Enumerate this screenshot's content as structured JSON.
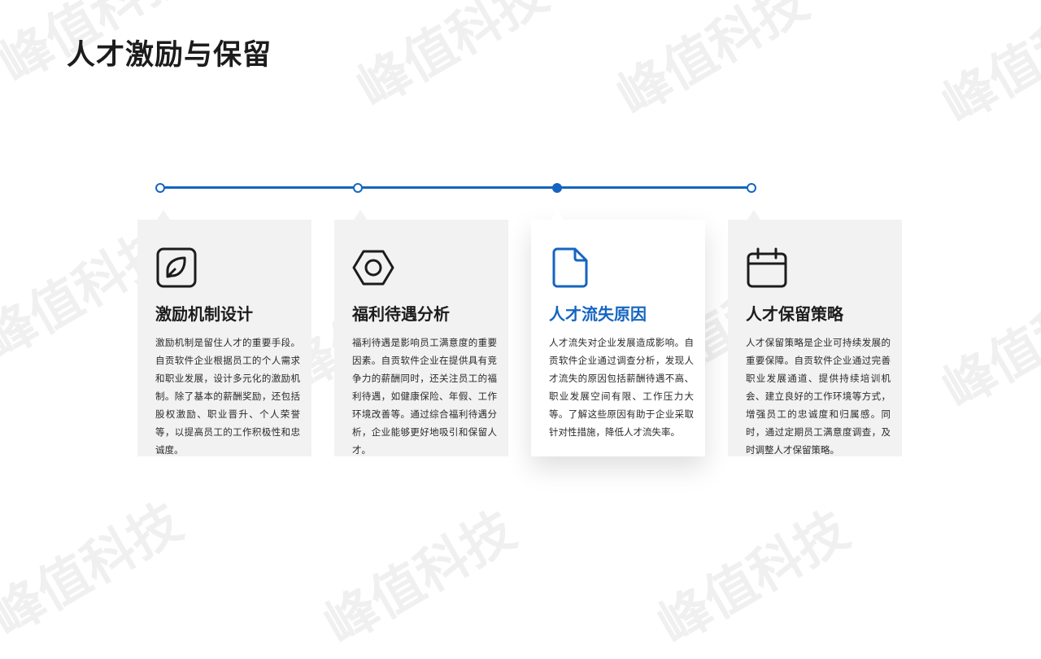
{
  "page": {
    "title": "人才激励与保留",
    "watermark": "峰值科技"
  },
  "colors": {
    "accent": "#1565c0",
    "card_bg": "#f2f2f2",
    "text": "#1c1c1c"
  },
  "timeline": {
    "active_index": 2,
    "points": 4
  },
  "cards": [
    {
      "icon": "leaf-icon",
      "title": "激励机制设计",
      "text": "激励机制是留住人才的重要手段。自贡软件企业根据员工的个人需求和职业发展，设计多元化的激励机制。除了基本的薪酬奖励，还包括股权激励、职业晋升、个人荣誉等，以提高员工的工作积极性和忠诚度。"
    },
    {
      "icon": "hex-nut-icon",
      "title": "福利待遇分析",
      "text": "福利待遇是影响员工满意度的重要因素。自贡软件企业在提供具有竞争力的薪酬同时，还关注员工的福利待遇，如健康保险、年假、工作环境改善等。通过综合福利待遇分析，企业能够更好地吸引和保留人才。"
    },
    {
      "icon": "document-icon",
      "title": "人才流失原因",
      "text": "人才流失对企业发展造成影响。自贡软件企业通过调查分析，发现人才流失的原因包括薪酬待遇不高、职业发展空间有限、工作压力大等。了解这些原因有助于企业采取针对性措施，降低人才流失率。"
    },
    {
      "icon": "calendar-icon",
      "title": "人才保留策略",
      "text": "人才保留策略是企业可持续发展的重要保障。自贡软件企业通过完善职业发展通道、提供持续培训机会、建立良好的工作环境等方式，增强员工的忠诚度和归属感。同时，通过定期员工满意度调查，及时调整人才保留策略。"
    }
  ]
}
